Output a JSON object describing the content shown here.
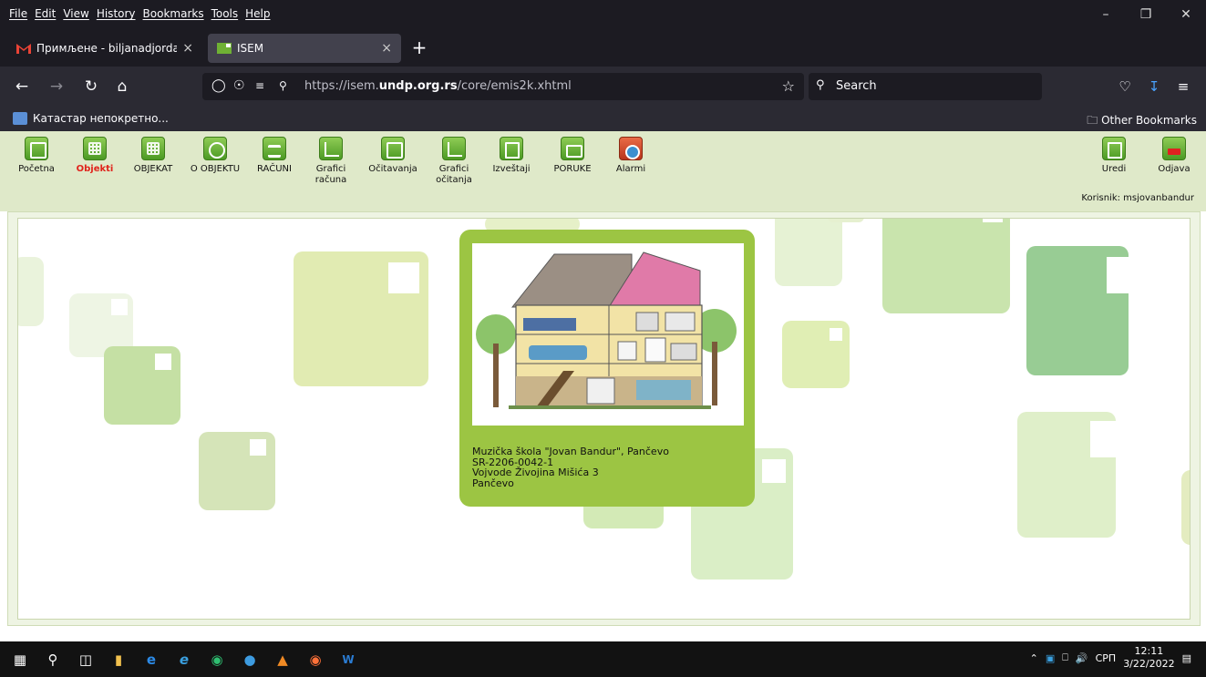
{
  "menubar": {
    "items": [
      "File",
      "Edit",
      "View",
      "History",
      "Bookmarks",
      "Tools",
      "Help"
    ]
  },
  "tabs": [
    {
      "title": "Примљене - biljanadjordan@g",
      "close": "×"
    },
    {
      "title": "ISEM",
      "close": "×"
    }
  ],
  "newtab": "+",
  "navbar": {
    "url_prefix": "https://isem.",
    "url_domain": "undp.org.rs",
    "url_path": "/core/emis2k.xhtml",
    "search_placeholder": "Search"
  },
  "bookmarks": {
    "item": "Катастар непокретно...",
    "other": "Other Bookmarks"
  },
  "toolbar": {
    "items": [
      {
        "label": "Početna"
      },
      {
        "label": "Objekti"
      },
      {
        "label": "OBJEKAT"
      },
      {
        "label": "O OBJEKTU"
      },
      {
        "label": "RAČUNI"
      },
      {
        "label": "Grafici računa"
      },
      {
        "label": "Očitavanja"
      },
      {
        "label": "Grafici očitanja"
      },
      {
        "label": "Izveštaji"
      },
      {
        "label": "PORUKE"
      },
      {
        "label": "Alarmi"
      }
    ],
    "right": [
      {
        "label": "Uredi"
      },
      {
        "label": "Odjava"
      }
    ],
    "user_label": "Korisnik:  msjovanbandur"
  },
  "card": {
    "line1": "Muzička škola \"Jovan Bandur\", Pančevo",
    "line2": "SR-2206-0042-1",
    "line3": "Vojvode Živojina Mišića 3",
    "line4": "Pančevo"
  },
  "taskbar": {
    "lang": "СРП",
    "time": "12:11",
    "date": "3/22/2022"
  },
  "colors": {
    "accent_green": "#9cc543",
    "active_red": "#e0231c",
    "toolbar_bg": "#dfe9c9"
  }
}
